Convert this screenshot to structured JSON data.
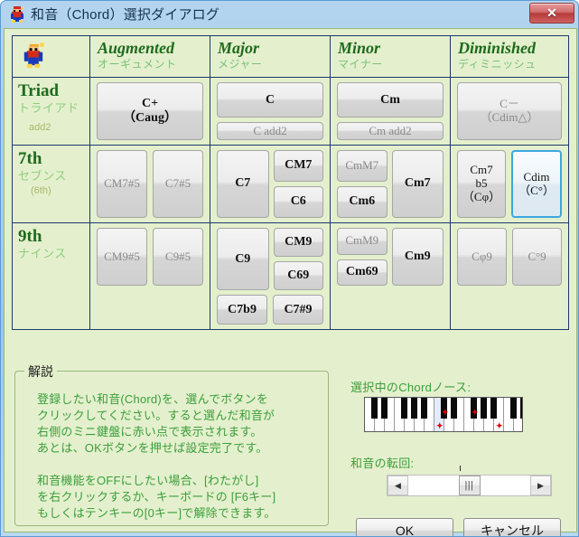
{
  "window": {
    "title": "和音（Chord）選択ダイアログ",
    "icon": "mario-character-icon",
    "close_label": "✕"
  },
  "table": {
    "corner_icon": "mario-character-icon",
    "columns": [
      {
        "en": "Augmented",
        "jp": "オーギュメント"
      },
      {
        "en": "Major",
        "jp": "メジャー"
      },
      {
        "en": "Minor",
        "jp": "マイナー"
      },
      {
        "en": "Diminished",
        "jp": "ディミニッシュ"
      }
    ],
    "rows": [
      {
        "en": "Triad",
        "jp": "トライアド",
        "sub": "add2"
      },
      {
        "en": "7th",
        "jp": "セブンス",
        "sub": "(6th)"
      },
      {
        "en": "9th",
        "jp": "ナインス",
        "sub": ""
      }
    ],
    "buttons": {
      "triad_aug": "C+\n（Caug）",
      "triad_maj": "C",
      "triad_maj_add2": "C add2",
      "triad_min": "Cm",
      "triad_min_add2": "Cm add2",
      "triad_dim": "C－\n（Cdim△）",
      "7th_aug_1": "CM7#5",
      "7th_aug_2": "C7#5",
      "7th_maj_1": "C7",
      "7th_maj_2": "CM7",
      "7th_maj_3": "C6",
      "7th_min_1": "CmM7",
      "7th_min_2": "Cm6",
      "7th_min_3": "Cm7",
      "7th_dim_1": "Cm7\nb5\n（Cφ）",
      "7th_dim_2": "Cdim\n（C°）",
      "9th_aug_1": "CM9#5",
      "9th_aug_2": "C9#5",
      "9th_maj_1": "C9",
      "9th_maj_2": "CM9",
      "9th_maj_3": "C69",
      "9th_maj_4": "C7b9",
      "9th_maj_5": "C7#9",
      "9th_min_1": "CmM9",
      "9th_min_2": "Cm69",
      "9th_min_3": "Cm9",
      "9th_dim_1": "Cφ9",
      "9th_dim_2": "C°9"
    },
    "selected_button": "7th_dim_2"
  },
  "explain": {
    "legend": "解説",
    "text": "登録したい和音(Chord)を、選んでボタンを\nクリックしてください。すると選んだ和音が\n右側のミニ鍵盤に赤い点で表示されます。\nあとは、OKボタンを押せば設定完了です。\n\n和音機能をOFFにしたい場合、[わたがし]\nを右クリックするか、キーボードの [F6キー]\nもしくはテンキーの[0キー]で解除できます。"
  },
  "source": {
    "label": "選択中のChordノース:",
    "keyboard_icon": "piano-keyboard-icon",
    "marker_color": "#e00000",
    "highlight_color": "#e3ecfb"
  },
  "inversion": {
    "label": "和音の転回:",
    "left_arrow": "◀",
    "right_arrow": "▶",
    "thumb_grip": "|||"
  },
  "footer": {
    "ok_label": "OK",
    "cancel_label": "キャンセル"
  }
}
